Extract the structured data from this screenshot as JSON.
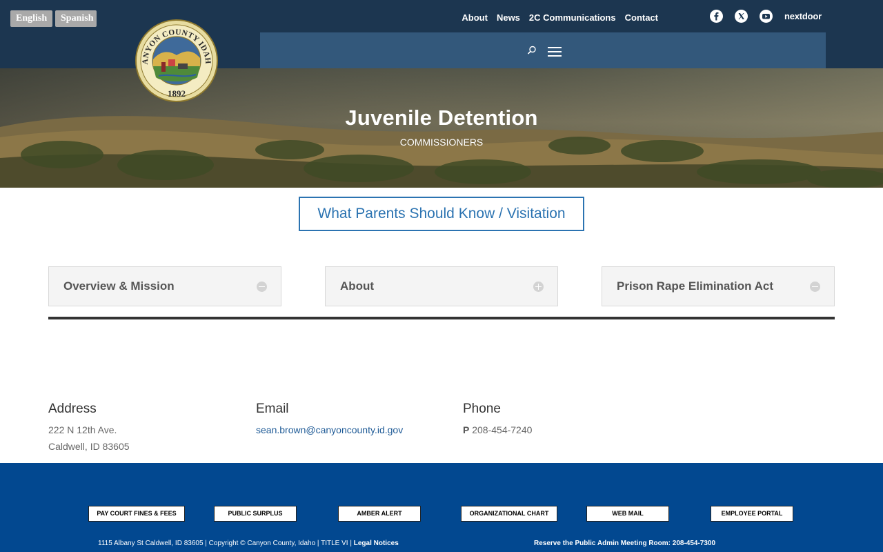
{
  "header": {
    "lang_english": "English",
    "lang_spanish": "Spanish",
    "nav": [
      "About",
      "News",
      "2C Communications",
      "Contact"
    ],
    "nextdoor": "nextdoor"
  },
  "seal": {
    "arc_text": "CANYON COUNTY IDAHO",
    "year": "1892"
  },
  "hero": {
    "title": "Juvenile Detention",
    "subtitle": "COMMISSIONERS"
  },
  "cta": {
    "label": "What Parents Should Know / Visitation"
  },
  "accordions": [
    {
      "label": "Overview & Mission",
      "icon": "minus-circle-icon"
    },
    {
      "label": "About",
      "icon": "plus-circle-icon"
    },
    {
      "label": "Prison Rape Elimination Act",
      "icon": "minus-circle-icon"
    }
  ],
  "contact": {
    "address_title": "Address",
    "address_line1": "222 N 12th Ave.",
    "address_line2": "Caldwell, ID 83605",
    "email_title": "Email",
    "email": "sean.brown@canyoncounty.id.gov",
    "phone_title": "Phone",
    "phone_prefix": "P",
    "phone": "208-454-7240"
  },
  "footer": {
    "buttons": [
      "PAY COURT FINES & FEES",
      "PUBLIC SURPLUS",
      "AMBER ALERT",
      "ORGANIZATIONAL CHART",
      "WEB MAIL",
      "EMPLOYEE PORTAL"
    ],
    "address_copyright": "1115 Albany St Caldwell, ID 83605 | Copyright © Canyon County, Idaho | TITLE VI | ",
    "legal": "Legal Notices",
    "reserve": "Reserve the Public Admin Meeting Room: 208-454-7300"
  }
}
